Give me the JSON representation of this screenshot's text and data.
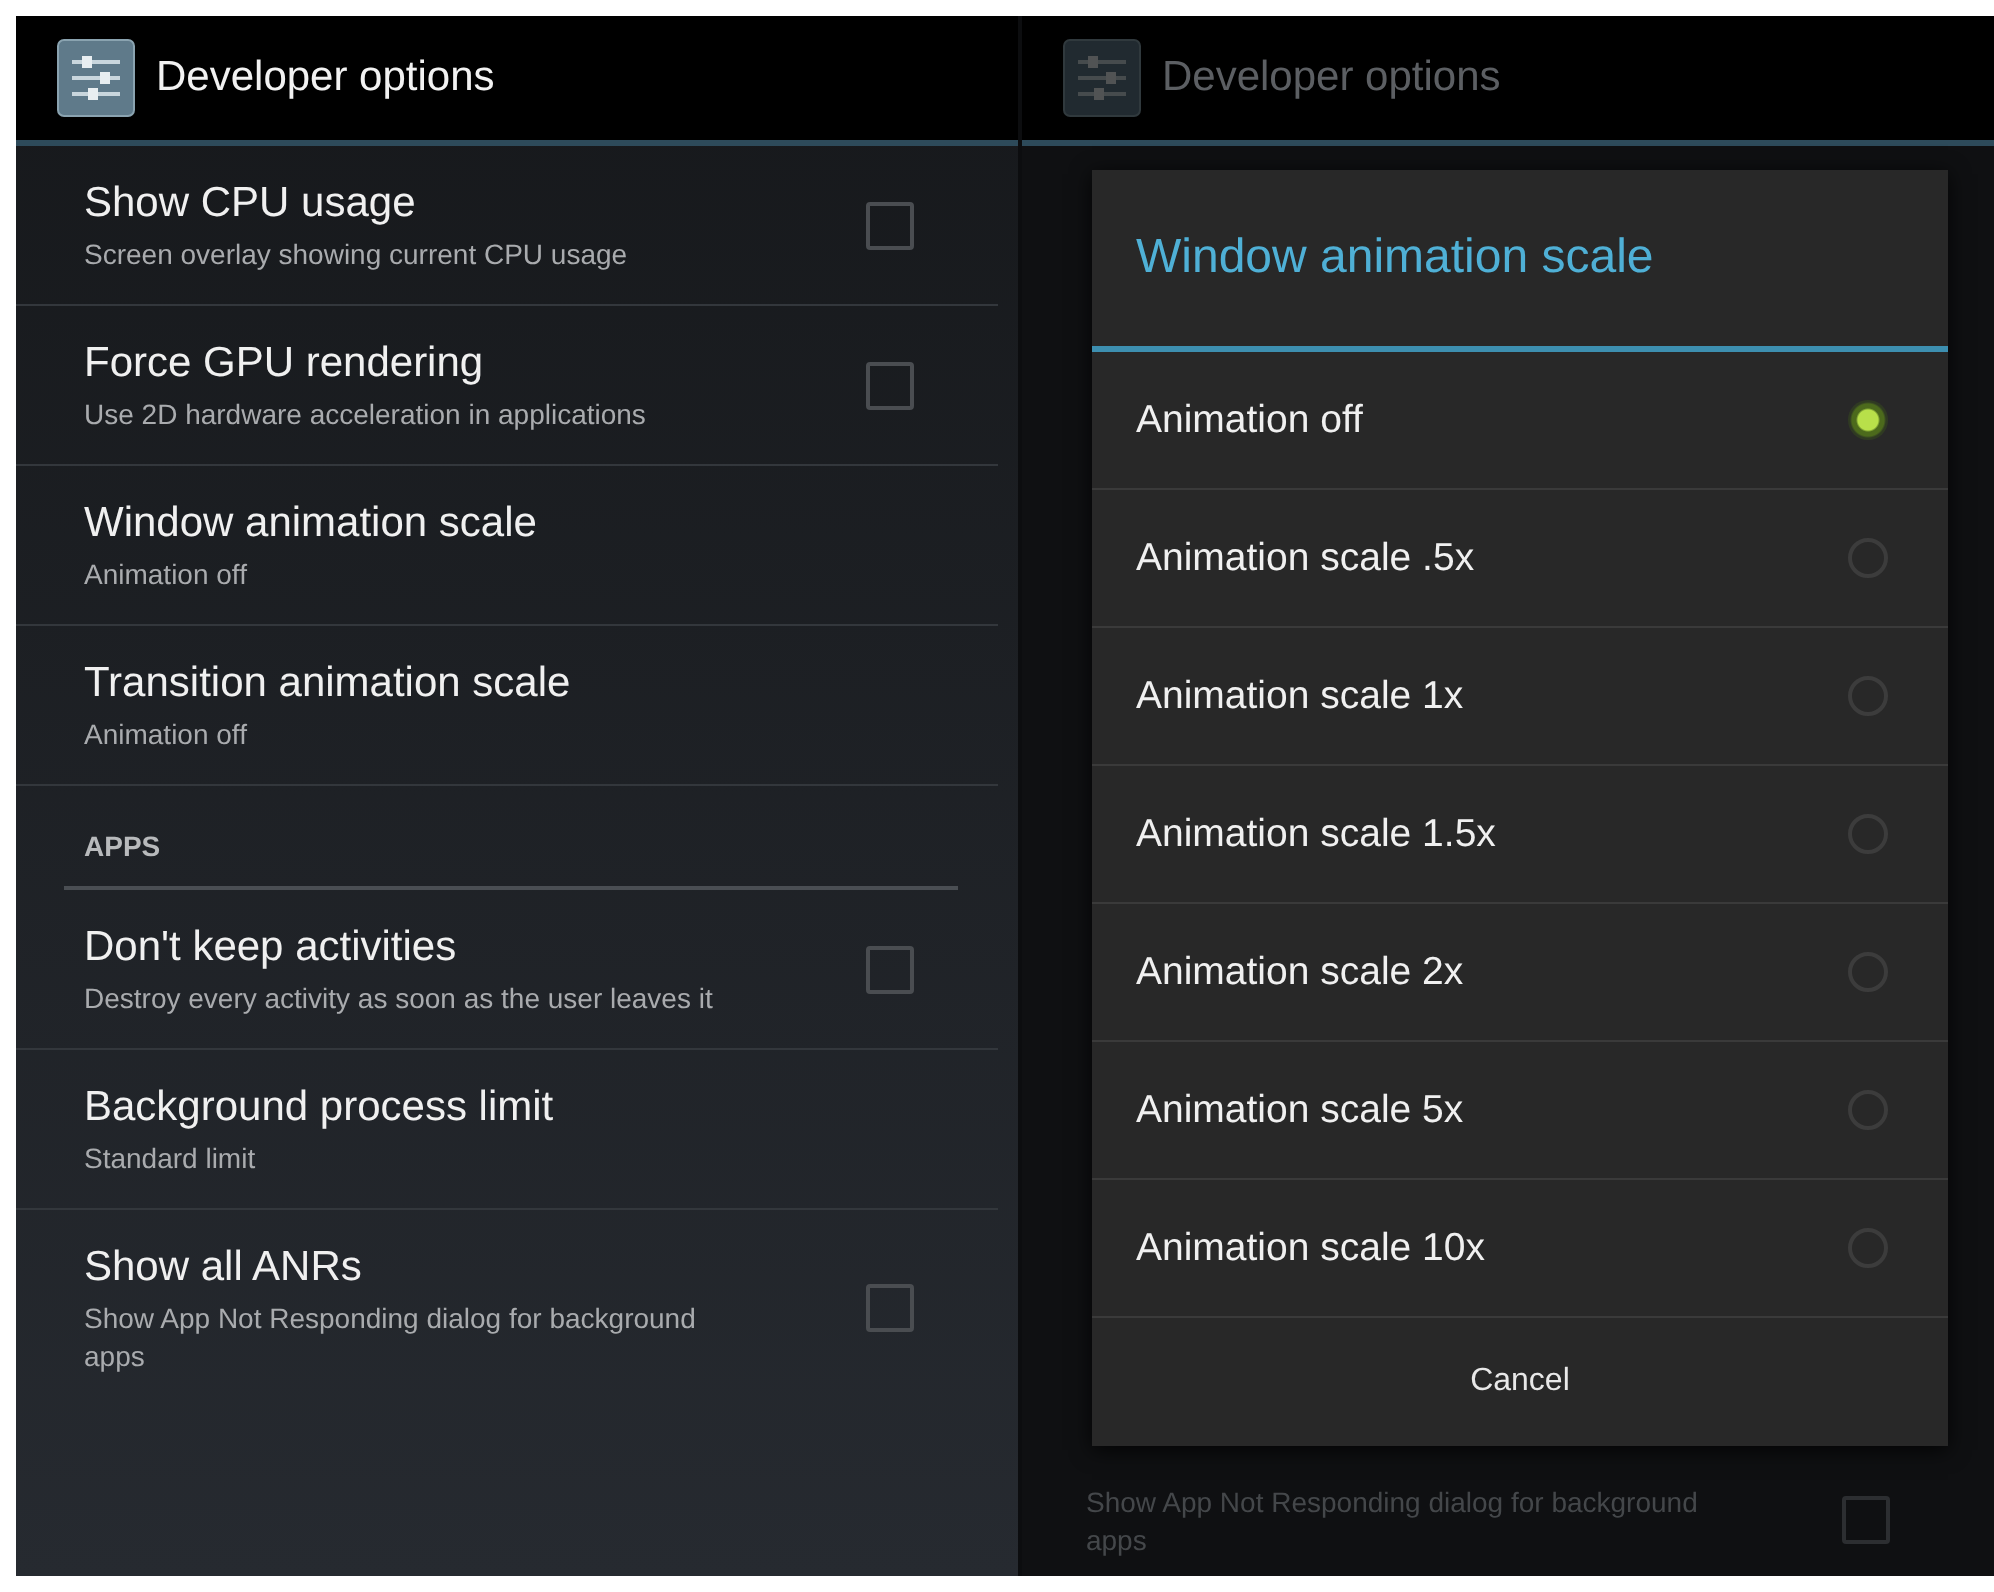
{
  "screens": [
    {
      "dimmed": false,
      "action_bar": {
        "title": "Developer options"
      },
      "items": [
        {
          "kind": "checkbox",
          "title": "Show CPU usage",
          "summary": "Screen overlay showing current CPU usage",
          "checked": false
        },
        {
          "kind": "checkbox",
          "title": "Force GPU rendering",
          "summary": "Use 2D hardware acceleration in applications",
          "checked": false
        },
        {
          "kind": "value",
          "title": "Window animation scale",
          "summary": "Animation off"
        },
        {
          "kind": "value",
          "title": "Transition animation scale",
          "summary": "Animation off"
        },
        {
          "kind": "header",
          "title": "APPS"
        },
        {
          "kind": "checkbox",
          "title": "Don't keep activities",
          "summary": "Destroy every activity as soon as the user leaves it",
          "checked": false
        },
        {
          "kind": "value",
          "title": "Background process limit",
          "summary": "Standard limit"
        },
        {
          "kind": "checkbox",
          "title": "Show all ANRs",
          "summary": "Show App Not Responding dialog for background apps",
          "checked": false
        }
      ]
    },
    {
      "dimmed": true,
      "action_bar": {
        "title": "Developer options"
      },
      "items": [
        {
          "kind": "checkbox",
          "summary": "Show App Not Responding dialog for background apps",
          "checked": false
        }
      ],
      "dialog": {
        "title": "Window animation scale",
        "options": [
          {
            "label": "Animation off",
            "selected": true
          },
          {
            "label": "Animation scale .5x",
            "selected": false
          },
          {
            "label": "Animation scale 1x",
            "selected": false
          },
          {
            "label": "Animation scale 1.5x",
            "selected": false
          },
          {
            "label": "Animation scale 2x",
            "selected": false
          },
          {
            "label": "Animation scale 5x",
            "selected": false
          },
          {
            "label": "Animation scale 10x",
            "selected": false
          }
        ],
        "button": "Cancel"
      }
    }
  ]
}
